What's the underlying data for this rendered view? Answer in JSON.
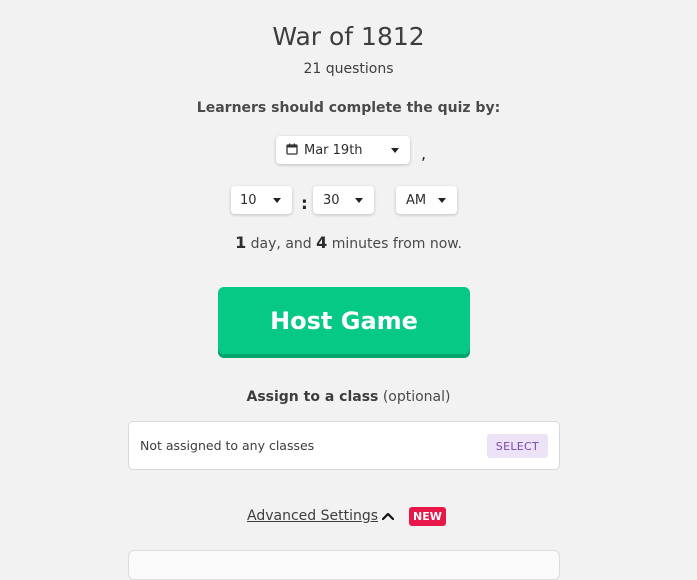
{
  "quiz": {
    "title": "War of 1812",
    "question_count": "21 questions"
  },
  "schedule": {
    "prompt": "Learners should complete the quiz by:",
    "date": "Mar 19th",
    "comma": ",",
    "hour": "10",
    "separator": ":",
    "minute": "30",
    "meridiem": "AM",
    "from_now": {
      "days_value": "1",
      "days_text": " day, and ",
      "minutes_value": "4",
      "minutes_text": " minutes from now."
    }
  },
  "host_button": {
    "label": "Host Game"
  },
  "assign": {
    "label_strong": "Assign to a class",
    "label_optional": " (optional)",
    "value": "Not assigned to any classes",
    "select_label": "SELECT"
  },
  "advanced": {
    "label": "Advanced Settings",
    "badge": "NEW"
  },
  "colors": {
    "primary": "#06c985",
    "badge": "#e8174a",
    "select_bg": "#ede3f7",
    "select_text": "#7a45b3"
  },
  "icons": [
    "calendar-icon",
    "caret-down-icon",
    "chevron-up-icon"
  ]
}
